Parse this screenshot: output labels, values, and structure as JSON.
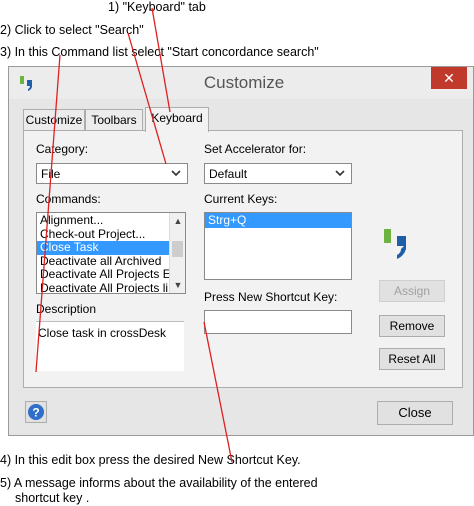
{
  "annotations": {
    "note1": "1) \"Keyboard\" tab",
    "note2": "2) Click to select \"Search\"",
    "note3": "3) In this Command list select \"Start concordance search\"",
    "note4": "4) In this edit box press the desired New Shortcut Key.",
    "note5_line1": "5) A message informs about the availability of the entered",
    "note5_line2": "shortcut key ."
  },
  "window": {
    "title": "Customize",
    "close_glyph": "✕"
  },
  "tabs": [
    "Customize",
    "Toolbars",
    "Keyboard"
  ],
  "category": {
    "label": "Category:",
    "value": "File"
  },
  "commands": {
    "label": "Commands:",
    "items": [
      "Alignment...",
      "Check-out Project...",
      "Close Task",
      "Deactivate all Archived",
      "Deactivate All Projects E",
      "Deactivate All Projects li"
    ],
    "selected_index": 2
  },
  "description": {
    "label": "Description",
    "text": "Close task in crossDesk"
  },
  "accelerator": {
    "label": "Set Accelerator for:",
    "value": "Default"
  },
  "current_keys": {
    "label": "Current Keys:",
    "items": [
      "Strg+Q"
    ]
  },
  "new_shortcut": {
    "label": "Press New Shortcut Key:",
    "value": ""
  },
  "buttons": {
    "assign": "Assign",
    "remove": "Remove",
    "reset_all": "Reset All",
    "close": "Close"
  },
  "icons": {
    "app_logo": "quote-logo-icon",
    "help": "help-icon",
    "chevron": "chevron-down-icon"
  },
  "colors": {
    "logo_blue": "#1f5fa8",
    "logo_green": "#6cb33f",
    "selection": "#3399ff",
    "close_red": "#c0392b",
    "arrow_red": "#e02020"
  }
}
